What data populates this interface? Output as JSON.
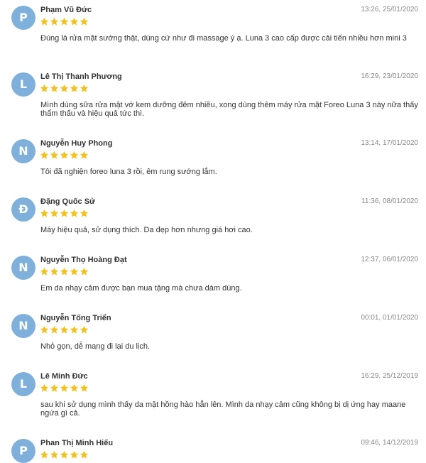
{
  "reviews": [
    {
      "initial": "P",
      "name": "Phạm Vũ Đức",
      "time": "13:26, 25/01/2020",
      "rating": 5,
      "text": "Đúng là rửa mặt sướng thật, dùng cứ như đi massage ý ạ. Luna 3 cao cấp được cải tiến nhiều hơn mini 3"
    },
    {
      "initial": "L",
      "name": "Lê Thị Thanh Phương",
      "time": "16:29, 23/01/2020",
      "rating": 5,
      "text": "Mình dùng sữa rửa mặt vớ kem dưỡng đêm nhiều, xong dùng thêm máy rửa mặt Foreo Luna 3 này nữa thấy thẩm thấu và hiệu quả tức thì."
    },
    {
      "initial": "N",
      "name": "Nguyễn Huy Phong",
      "time": "13:14, 17/01/2020",
      "rating": 5,
      "text": "Tôi đã nghiện foreo luna 3 rồi, êm rung sướng lắm."
    },
    {
      "initial": "Đ",
      "name": "Đặng Quốc Sử",
      "time": "11:36, 08/01/2020",
      "rating": 5,
      "text": "Máy hiệu quả, sử dụng thích. Da đẹp hơn nhưng giá hơi cao."
    },
    {
      "initial": "N",
      "name": "Nguyễn Thọ Hoàng Đạt",
      "time": "12:37, 06/01/2020",
      "rating": 5,
      "text": "Em da nhạy cảm được bạn mua tặng mà chưa dám dùng."
    },
    {
      "initial": "N",
      "name": "Nguyễn Tống Triển",
      "time": "00:01, 01/01/2020",
      "rating": 5,
      "text": "Nhỏ gọn, dễ mang đi lại du lịch."
    },
    {
      "initial": "L",
      "name": "Lê Minh Đức",
      "time": "16:29, 25/12/2019",
      "rating": 5,
      "text": "sau khi sử dụng mình thấy da mặt hồng hào hẳn lên. Mình da nhạy cảm cũng không bị dị ứng hay maane ngứa gì cả."
    },
    {
      "initial": "P",
      "name": "Phan Thị Minh Hiếu",
      "time": "09:46, 14/12/2019",
      "rating": 5,
      "text": ""
    }
  ],
  "colors": {
    "avatar": "#7fb0dc",
    "star": "#f2c21b",
    "name": "#333333",
    "time": "#888888"
  },
  "icons": {
    "star": "star-icon"
  }
}
